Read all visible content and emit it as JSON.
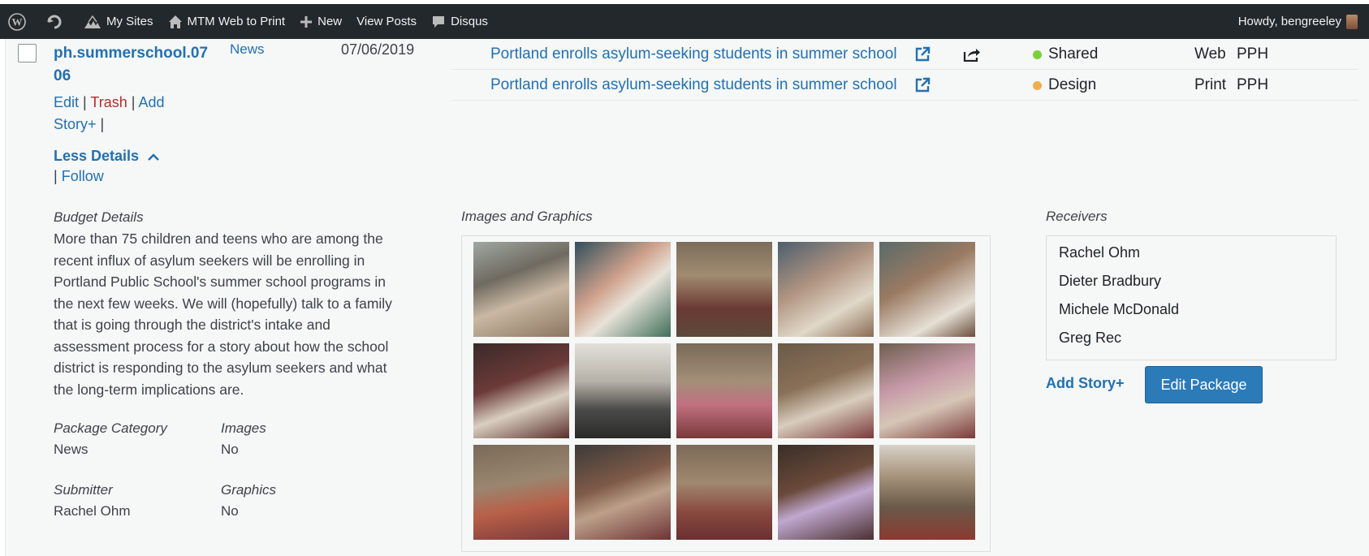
{
  "adminbar": {
    "my_sites": "My Sites",
    "site_name": "MTM Web to Print",
    "new": "New",
    "view_posts": "View Posts",
    "disqus": "Disqus",
    "howdy": "Howdy, bengreeley"
  },
  "package": {
    "slug": "ph.summerschool.0706",
    "actions": {
      "edit": "Edit",
      "trash": "Trash",
      "add_story": "Add Story+",
      "sep": "|"
    },
    "less_details": "Less Details",
    "follow_sep": "|",
    "follow": "Follow",
    "category": "News",
    "date": "07/06/2019"
  },
  "stories": [
    {
      "title": "Portland enrolls asylum-seeking students in summer school",
      "status": "Shared",
      "status_color": "#7ad03a",
      "medium": "Web",
      "publication": "PPH",
      "has_share": true
    },
    {
      "title": "Portland enrolls asylum-seeking students in summer school",
      "status": "Design",
      "status_color": "#f0ad4e",
      "medium": "Print",
      "publication": "PPH",
      "has_share": false
    }
  ],
  "details": {
    "budget_label": "Budget Details",
    "budget_text": "More than 75 children and teens who are among the recent influx of asylum seekers will be enrolling in Portland Public School's summer school programs in the next few weeks. We will (hopefully) talk to a family that is going through the district's intake and assessment process for a story about how the school district is responding to the asylum seekers and what the long-term implications are.",
    "package_category_label": "Package Category",
    "package_category": "News",
    "images_label": "Images",
    "images": "No",
    "submitter_label": "Submitter",
    "submitter": "Rachel Ohm",
    "graphics_label": "Graphics",
    "graphics": "No"
  },
  "images_section": {
    "label": "Images and Graphics",
    "count": 15
  },
  "receivers": {
    "label": "Receivers",
    "names": [
      "Rachel Ohm",
      "Dieter Bradbury",
      "Michele McDonald",
      "Greg Rec"
    ]
  },
  "buttons": {
    "add_story": "Add Story+",
    "edit_package": "Edit Package"
  },
  "colors": {
    "link": "#2271b1",
    "trash": "#b32d2e",
    "adminbar": "#23282d",
    "primary_button": "#2b7bb9"
  }
}
